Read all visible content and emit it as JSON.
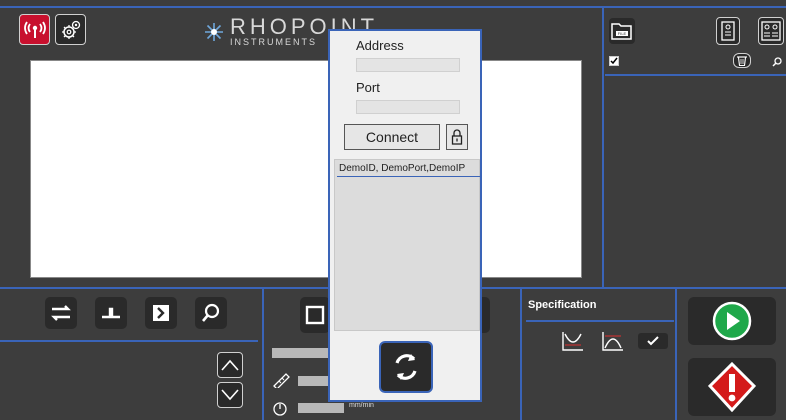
{
  "header": {
    "logo_main": "RHOPOINT",
    "logo_sub": "INSTRUMENTS",
    "checkbox_checked": true
  },
  "dialog": {
    "address_label": "Address",
    "address_value": "",
    "port_label": "Port",
    "port_value": "",
    "connect_label": "Connect",
    "list_items": [
      "DemoID, DemoPort,DemoIP"
    ]
  },
  "specification": {
    "label": "Specification"
  },
  "bottom": {
    "speed_unit": "mm/min"
  },
  "colors": {
    "accent": "#3a64b8",
    "background": "#3d3d3d",
    "connect_icon": "#c8102e",
    "play": "#1fa84a",
    "alert": "#d41a1a"
  },
  "icons": {
    "connection": "antenna-icon",
    "settings": "gear-icon",
    "file": "file-folder-icon",
    "report_a": "report-icon",
    "report_b": "report-compare-icon",
    "delete": "trash-icon",
    "zoom": "magnifier-icon",
    "lock": "lock-icon",
    "refresh": "refresh-icon",
    "play": "play-icon",
    "alert": "alert-icon"
  }
}
